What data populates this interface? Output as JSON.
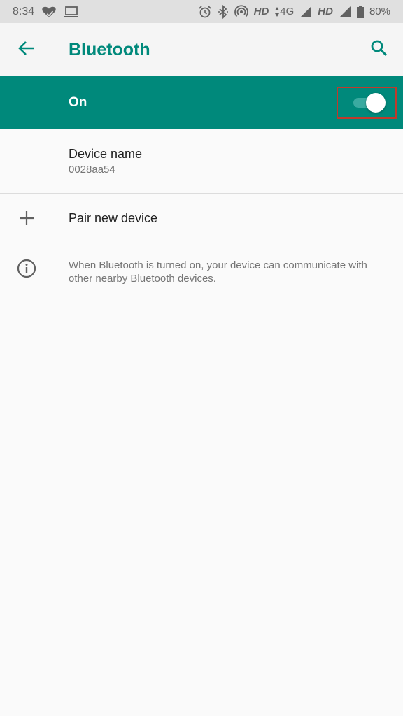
{
  "status_bar": {
    "time": "8:34",
    "left_icons": [
      "health-heart-check-icon",
      "laptop-icon"
    ],
    "right_icons": [
      "alarm-icon",
      "bluetooth-icon",
      "hotspot-icon"
    ],
    "hd1": "HD",
    "network_type": "4G",
    "hd2": "HD",
    "battery_percent": "80%"
  },
  "app_bar": {
    "title": "Bluetooth",
    "back_icon": "arrow-back-icon",
    "search_icon": "search-icon"
  },
  "master_switch": {
    "label": "On",
    "checked": true,
    "accent_color": "#00897b"
  },
  "items": {
    "device_name": {
      "title": "Device name",
      "value": "0028aa54"
    },
    "pair_new_device": {
      "title": "Pair new device",
      "icon": "plus-icon"
    },
    "info": {
      "icon": "info-icon",
      "text": "When Bluetooth is turned on, your device can communicate with other nearby Bluetooth devices."
    }
  }
}
